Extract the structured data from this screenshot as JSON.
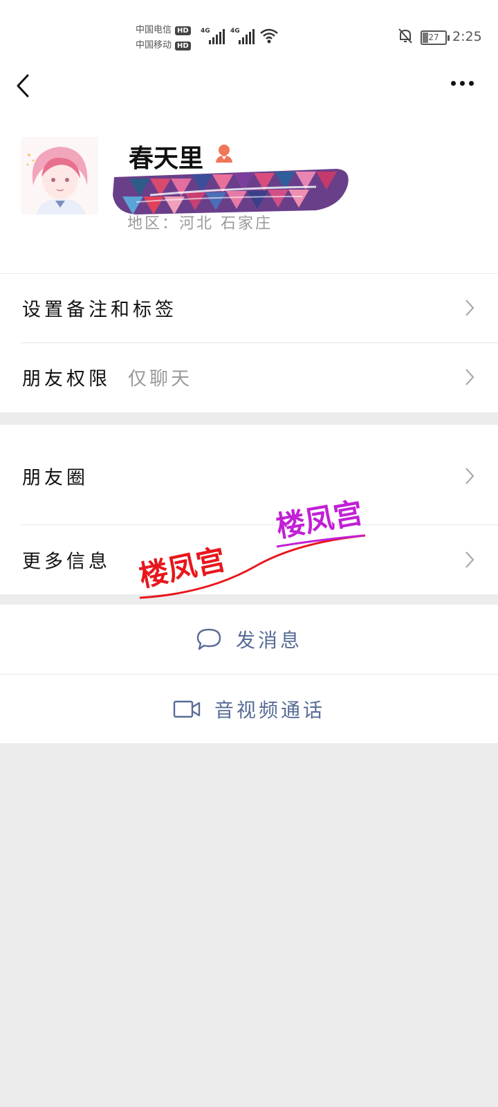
{
  "status_bar": {
    "carrier1": "中国电信",
    "carrier2": "中国移动",
    "hd": "HD",
    "net1": "4G",
    "net2": "4G",
    "battery": "27",
    "time": "2:25"
  },
  "profile": {
    "name": "春天里",
    "region": "地区：河北 石家庄"
  },
  "settings": [
    {
      "label": "设置备注和标签",
      "value": ""
    },
    {
      "label": "朋友权限",
      "value": "仅聊天"
    }
  ],
  "info": [
    {
      "label": "朋友圈"
    },
    {
      "label": "更多信息"
    }
  ],
  "actions": {
    "message": "发消息",
    "call": "音视频通话"
  },
  "watermark": "楼凤宫",
  "colors": {
    "link": "#576b95",
    "background": "#ececec",
    "watermark_red": "#e8161c",
    "watermark_purple": "#c21fd6"
  }
}
